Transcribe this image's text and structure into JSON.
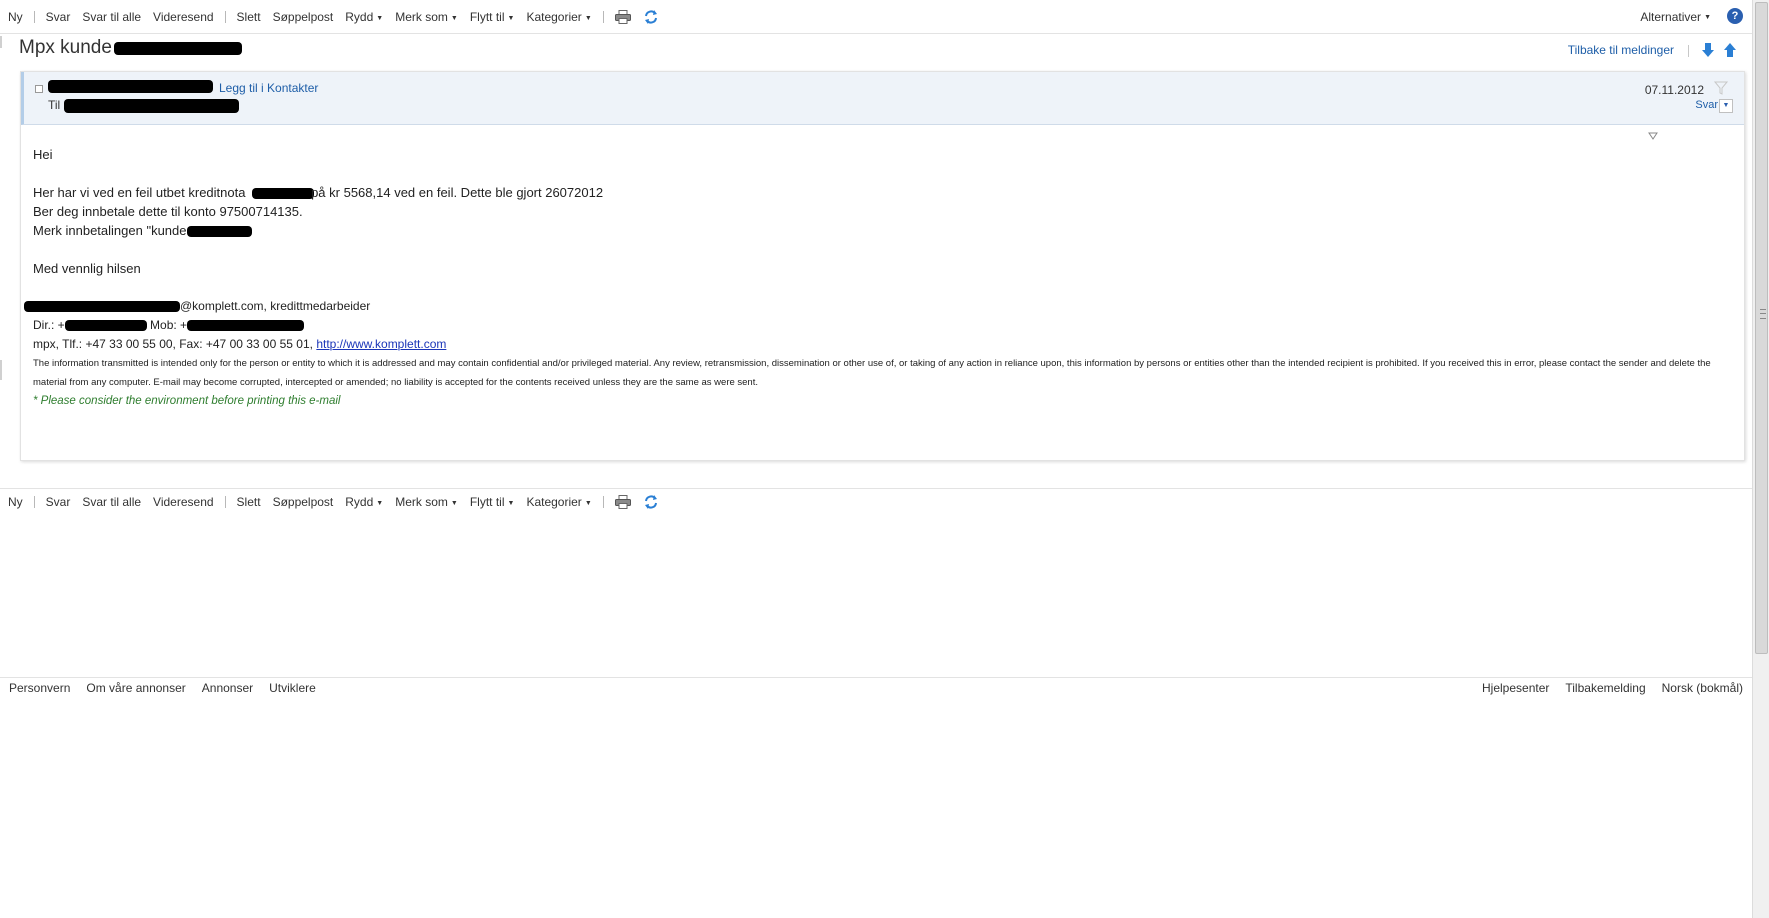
{
  "toolbar": {
    "new_label": "Ny",
    "reply_label": "Svar",
    "reply_all_label": "Svar til alle",
    "forward_label": "Videresend",
    "delete_label": "Slett",
    "junk_label": "Søppelpost",
    "sweep_label": "Rydd",
    "mark_as_label": "Merk som",
    "move_to_label": "Flytt til",
    "categories_label": "Kategorier",
    "print_icon": "print-icon",
    "refresh_icon": "refresh-icon"
  },
  "header_right": {
    "options_label": "Alternativer",
    "help_icon": "help-icon"
  },
  "message": {
    "subject": "Mpx kunde",
    "back_label": "Tilbake til meldinger",
    "add_contact_label": "Legg til i Kontakter",
    "to_label": "Til",
    "date": "07.11.2012",
    "reply_label": "Svar",
    "body": {
      "greeting": "Hei",
      "line1_a": "Her har vi ved en feil utbet kreditnota",
      "line1_b": "på kr 5568,14 ved en feil. Dette ble gjort 26072012",
      "line2": "Ber deg innbetale dette til konto 97500714135.",
      "line3": "Merk innbetalingen \"kunde",
      "closing": "Med vennlig hilsen"
    },
    "signature": {
      "email_suffix": "@komplett.com, kredittmedarbeider",
      "dir_label": "Dir.: +",
      "mob_label": "Mob: +",
      "company_line": "mpx, Tlf.: +47 33 00 55 00, Fax: +47 00 33 00 55 01,",
      "website": "http://www.komplett.com",
      "disclaimer": "The information transmitted is intended only for the person or entity to which it is addressed and may contain confidential and/or privileged material. Any review, retransmission, dissemination or other use of, or taking of any action in reliance upon, this information by persons or entities other than the intended recipient is prohibited. If you received this in error, please contact the sender and delete the material from any computer. E-mail may become corrupted, intercepted or amended; no liability is accepted for the contents received unless they are the same as were sent.",
      "environment_note": "* Please consider the environment before printing this e-mail"
    }
  },
  "footer": {
    "privacy": "Personvern",
    "about_ads": "Om våre annonser",
    "advertise": "Annonser",
    "developers": "Utviklere",
    "help_center": "Hjelpesenter",
    "feedback": "Tilbakemelding",
    "language": "Norsk (bokmål)"
  },
  "colors": {
    "link": "#1e5ea8",
    "header_bg": "#eef3f9",
    "green_note": "#2e7d2e"
  }
}
